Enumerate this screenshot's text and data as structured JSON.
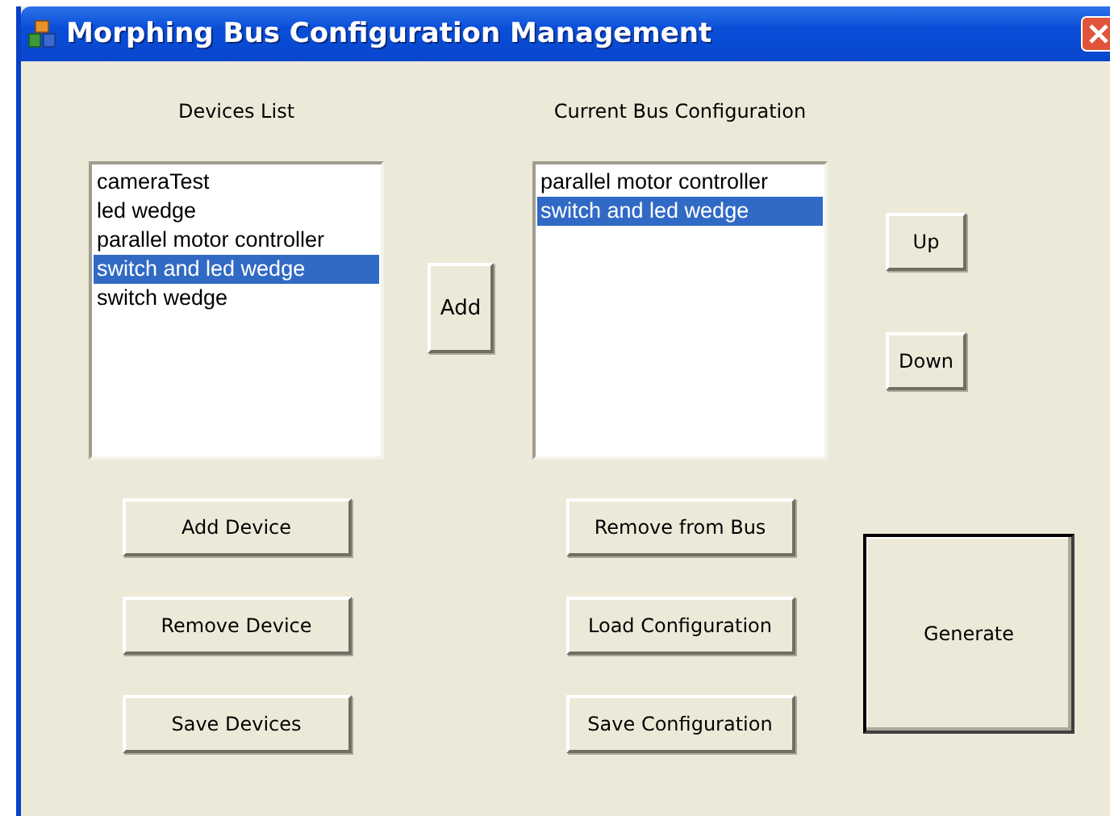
{
  "window": {
    "title": "Morphing Bus Configuration Management"
  },
  "devices_list": {
    "label": "Devices List",
    "items": [
      {
        "text": "cameraTest",
        "selected": false
      },
      {
        "text": "led wedge",
        "selected": false
      },
      {
        "text": "parallel motor controller",
        "selected": false
      },
      {
        "text": "switch and led wedge",
        "selected": true
      },
      {
        "text": "switch wedge",
        "selected": false
      }
    ]
  },
  "add_button": "Add",
  "bus_configuration": {
    "label": "Current Bus Configuration",
    "items": [
      {
        "text": "parallel motor controller",
        "selected": false
      },
      {
        "text": "switch and led wedge",
        "selected": true
      }
    ]
  },
  "up_button": "Up",
  "down_button": "Down",
  "device_buttons": [
    "Add Device",
    "Remove Device",
    "Save Devices"
  ],
  "configuration_buttons": [
    "Remove from Bus",
    "Load Configuration",
    "Save Configuration"
  ],
  "generate_button": "Generate"
}
